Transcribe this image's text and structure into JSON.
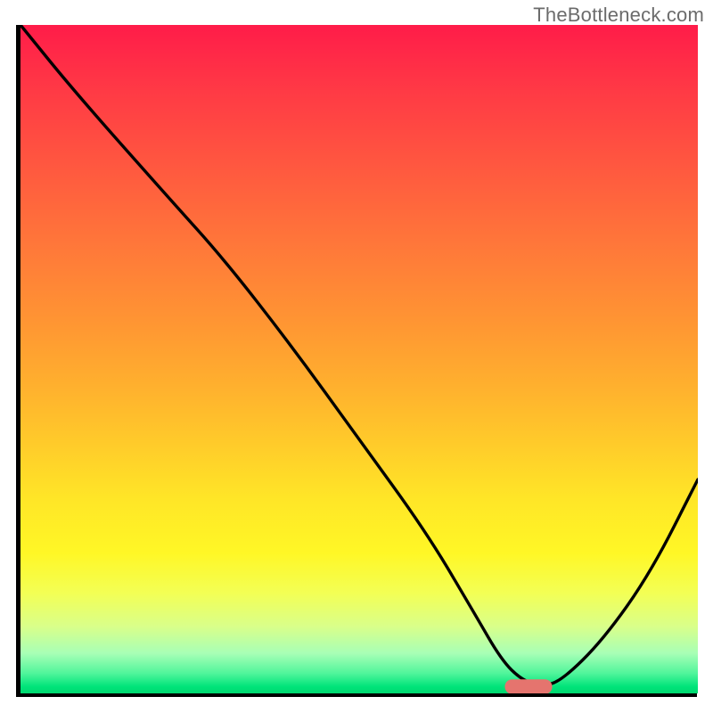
{
  "watermark": "TheBottleneck.com",
  "chart_data": {
    "type": "line",
    "title": "",
    "xlabel": "",
    "ylabel": "",
    "xlim": [
      0,
      100
    ],
    "ylim": [
      0,
      100
    ],
    "grid": false,
    "legend": false,
    "series": [
      {
        "name": "bottleneck-curve",
        "x": [
          0,
          8,
          22,
          30,
          40,
          50,
          60,
          67,
          71,
          74,
          77,
          80,
          86,
          93,
          100
        ],
        "y": [
          100,
          90,
          74,
          65,
          52,
          38,
          24,
          12,
          5,
          2,
          1,
          2,
          8,
          18,
          32
        ]
      }
    ],
    "marker": {
      "name": "optimal-region",
      "x_center": 75,
      "y": 1,
      "width": 7,
      "height": 2.2,
      "color": "#e5746e"
    },
    "background_gradient": {
      "stops": [
        {
          "pos": 0,
          "color": "#ff1c49"
        },
        {
          "pos": 22,
          "color": "#ff5a3f"
        },
        {
          "pos": 44,
          "color": "#ff9433"
        },
        {
          "pos": 63,
          "color": "#ffcc2a"
        },
        {
          "pos": 79,
          "color": "#fff726"
        },
        {
          "pos": 94,
          "color": "#a8ffb6"
        },
        {
          "pos": 100,
          "color": "#00d86f"
        }
      ]
    }
  }
}
